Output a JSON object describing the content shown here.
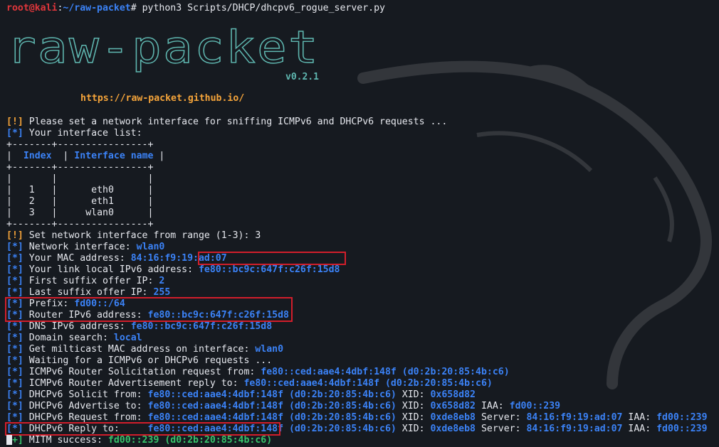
{
  "prompt": {
    "user_host": "root@kali",
    "sep": ":",
    "path": "~/raw-packet",
    "symbol": "# ",
    "command": "python3 Scripts/DHCP/dhcpv6_rogue_server.py"
  },
  "banner": {
    "logo_text": "raw-packet",
    "version": "v0.2.1",
    "url": "https://raw-packet.github.io/"
  },
  "lines": {
    "set_iface_prefix": "[!]",
    "set_iface_text": " Please set a network interface for sniffing ICMPv6 and DHCPv6 requests ...",
    "iface_list_prefix": "[*]",
    "iface_list_text": " Your interface list:"
  },
  "table": {
    "border": "+-------+----------------+",
    "col_index": "Index",
    "col_name": "Interface name",
    "rows": [
      {
        "index": "1",
        "name": "eth0"
      },
      {
        "index": "2",
        "name": "eth1"
      },
      {
        "index": "3",
        "name": "wlan0"
      }
    ]
  },
  "output": {
    "range_prefix": "[!]",
    "range_text": " Set network interface from range (1-3): 3",
    "info": "[*]",
    "ok": "[+]",
    "net_iface_label": " Network interface: ",
    "net_iface_value": "wlan0",
    "mac_label": " Your MAC address: ",
    "mac_value": "84:16:f9:19:ad:07",
    "lla_label": " Your link local IPv6 address: ",
    "lla_value": "fe80::bc9c:647f:c26f:15d8",
    "first_label": " First suffix offer IP: ",
    "first_value": "2",
    "last_label": " Last suffix offer IP: ",
    "last_value": "255",
    "prefix_label": " Prefix: ",
    "prefix_value": "fd00::/64",
    "router_label": " Router IPv6 address: ",
    "router_value": "fe80::bc9c:647f:c26f:15d8",
    "dns_label": " DNS IPv6 address: ",
    "dns_value": "fe80::bc9c:647f:c26f:15d8",
    "domain_label": " Domain search: ",
    "domain_value": "local",
    "mcast_label": " Get milticast MAC address on interface: ",
    "mcast_value": "wlan0",
    "waiting_text": " Waiting for a ICMPv6 or DHCPv6 requests ...",
    "rs_label": " ICMPv6 Router Solicitation request from: ",
    "rs_value": "fe80::ced:aae4:4dbf:148f (d0:2b:20:85:4b:c6)",
    "ra_label": " ICMPv6 Router Advertisement reply to: ",
    "ra_value": "fe80::ced:aae4:4dbf:148f (d0:2b:20:85:4b:c6)",
    "solicit_label": " DHCPv6 Solicit from: ",
    "solicit_value": "fe80::ced:aae4:4dbf:148f (d0:2b:20:85:4b:c6)",
    "solicit_xid_label": " XID: ",
    "solicit_xid": "0x658d82",
    "advertise_label": " DHCPv6 Advertise to: ",
    "advertise_value": "fe80::ced:aae4:4dbf:148f (d0:2b:20:85:4b:c6)",
    "advertise_xid_label": " XID: ",
    "advertise_xid": "0x658d82",
    "advertise_iaa_label": " IAA: ",
    "advertise_iaa": "fd00::239",
    "request_label": " DHCPv6 Request from: ",
    "request_value": "fe80::ced:aae4:4dbf:148f (d0:2b:20:85:4b:c6)",
    "request_xid_label": " XID: ",
    "request_xid": "0xde8eb8",
    "request_server_label": " Server: ",
    "request_server": "84:16:f9:19:ad:07",
    "request_iaa_label": " IAA: ",
    "request_iaa": "fd00::239",
    "reply_label": " DHCPv6 Reply to:     ",
    "reply_value": "fe80::ced:aae4:4dbf:148f (d0:2b:20:85:4b:c6)",
    "reply_xid_label": " XID: ",
    "reply_xid": "0xde8eb8",
    "reply_server_label": " Server: ",
    "reply_server": "84:16:f9:19:ad:07",
    "reply_iaa_label": " IAA: ",
    "reply_iaa": "fd00::239",
    "mitm_label": " MITM success: ",
    "mitm_value": "fd00::239 (d0:2b:20:85:4b:c6)"
  },
  "colors": {
    "background": "#161a20",
    "text": "#e6e8ee",
    "info_blue": "#3b82f6",
    "warn_orange": "#f5a43a",
    "ok_green": "#36c36b",
    "prompt_red": "#e0363b",
    "highlight_box": "#d21e2b",
    "logo_teal": "#5fb7b0"
  }
}
